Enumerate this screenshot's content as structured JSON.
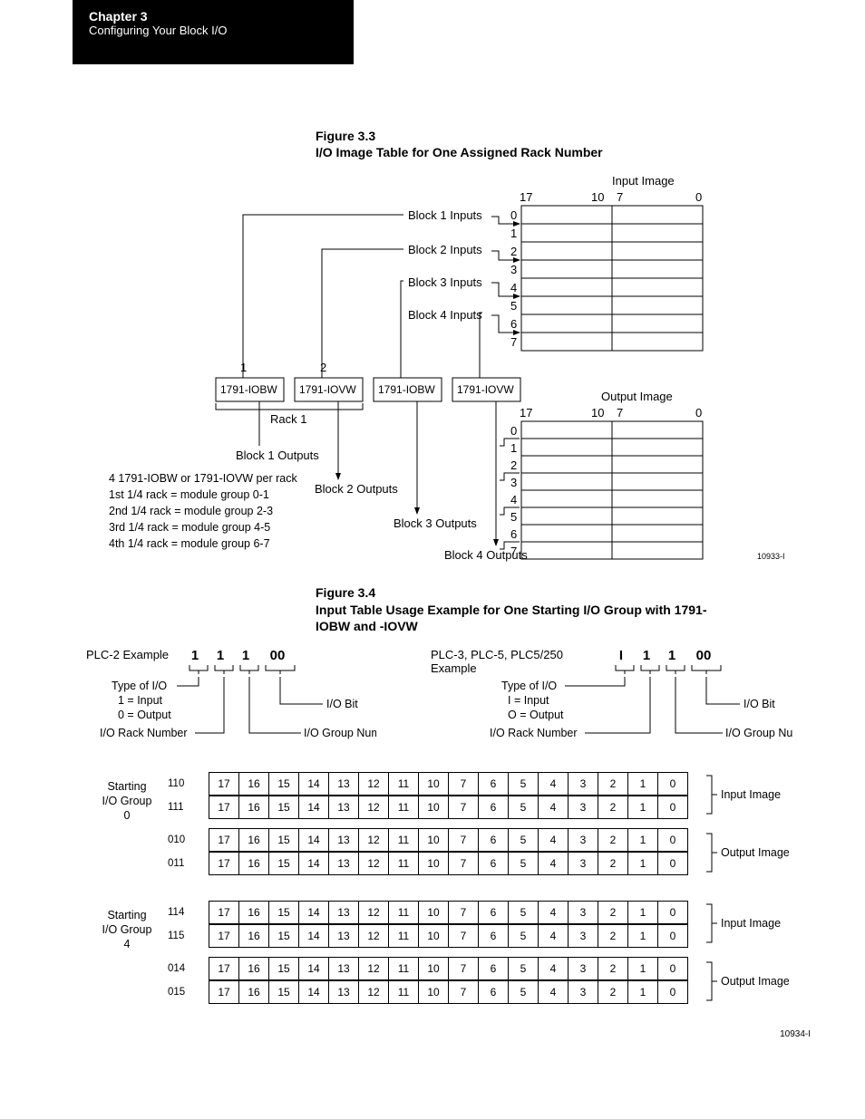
{
  "chapter": {
    "title": "Chapter 3",
    "sub": "Configuring Your Block I/O"
  },
  "fig33": {
    "number": "Figure 3.3",
    "title": "I/O Image Table for One Assigned Rack Number",
    "input_image": "Input Image",
    "output_image": "Output Image",
    "col_labels": [
      "17",
      "10",
      "7",
      "0"
    ],
    "row_labels": [
      "0",
      "1",
      "2",
      "3",
      "4",
      "5",
      "6",
      "7"
    ],
    "blocks_in": [
      "Block 1 Inputs",
      "Block 2 Inputs",
      "Block 3 Inputs",
      "Block 4 Inputs"
    ],
    "blocks_out": [
      "Block 1 Outputs",
      "Block 2 Outputs",
      "Block 3 Outputs",
      "Block 4 Outputs"
    ],
    "module_nums": [
      "1",
      "2"
    ],
    "module_names": [
      "1791-IOBW",
      "1791-IOVW",
      "1791-IOBW",
      "1791-IOVW"
    ],
    "rack": "Rack 1",
    "notes": [
      "4 1791-IOBW or 1791-IOVW per rack",
      "1st 1/4 rack = module group 0-1",
      "2nd 1/4 rack = module group 2-3",
      "3rd 1/4 rack = module group 4-5",
      "4th 1/4 rack = module group 6-7"
    ],
    "ref": "10933-I"
  },
  "fig34": {
    "number": "Figure 3.4",
    "title": "Input Table Usage Example for One Starting I/O Group with 1791-IOBW and -IOVW",
    "plc2_label": "PLC-2 Example",
    "plc3_label": "PLC-3, PLC-5, PLC5/250 Example",
    "digits_plc2": [
      "1",
      "1",
      "1",
      "00"
    ],
    "digits_plc3": [
      "I",
      "1",
      "1",
      "00"
    ],
    "type_label": "Type of I/O",
    "plc2_types": [
      "1 = Input",
      "0 = Output"
    ],
    "plc3_types": [
      "I = Input",
      "O = Output"
    ],
    "io_bit": "I/O Bit",
    "rack_num": "I/O Rack Number",
    "group_num": "I/O Group Number",
    "groups": [
      {
        "label": "Starting I/O Group 0",
        "rows": [
          {
            "addr": "110",
            "type": "Input Image"
          },
          {
            "addr": "111",
            "type": ""
          },
          {
            "addr": "010",
            "type": "Output Image"
          },
          {
            "addr": "011",
            "type": ""
          }
        ]
      },
      {
        "label": "Starting I/O Group 4",
        "rows": [
          {
            "addr": "114",
            "type": "Input Image"
          },
          {
            "addr": "115",
            "type": ""
          },
          {
            "addr": "014",
            "type": "Output Image"
          },
          {
            "addr": "015",
            "type": ""
          }
        ]
      }
    ],
    "bits": [
      "17",
      "16",
      "15",
      "14",
      "13",
      "12",
      "11",
      "10",
      "7",
      "6",
      "5",
      "4",
      "3",
      "2",
      "1",
      "0"
    ],
    "ref": "10934-I"
  }
}
